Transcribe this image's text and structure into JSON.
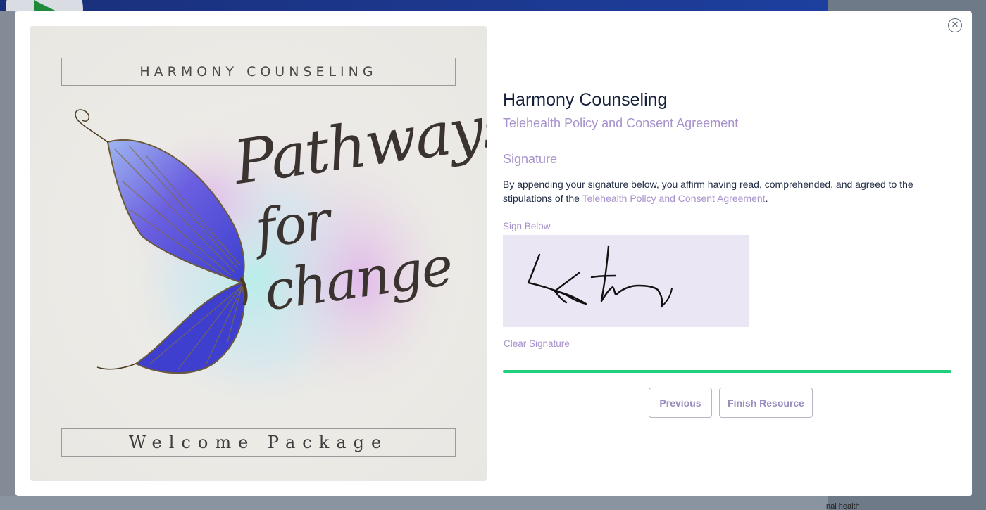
{
  "background": {
    "footer_text": "nal health"
  },
  "modal": {
    "close_label": "✕",
    "cover": {
      "top_title": "HARMONY COUNSELING",
      "script_line_1": "Pathways",
      "script_line_2": "for change",
      "bottom_title": "Welcome Package"
    },
    "title": "Harmony Counseling",
    "subtitle": "Telehealth Policy and Consent Agreement",
    "signature_heading": "Signature",
    "affirm_text_prefix": "By appending your signature below, you affirm having read, comprehended, and agreed to the stipulations of the ",
    "affirm_link": "Telehealth Policy and Consent Agreement",
    "affirm_text_suffix": ".",
    "sign_below_label": "Sign Below",
    "clear_signature_label": "Clear Signature",
    "progress_percent": 100,
    "buttons": {
      "previous": "Previous",
      "finish": "Finish Resource"
    }
  },
  "colors": {
    "accent_purple": "#a792cc",
    "title_navy": "#15203a",
    "progress_green": "#22cf7a",
    "signature_pad_bg": "#ebe6f3"
  }
}
